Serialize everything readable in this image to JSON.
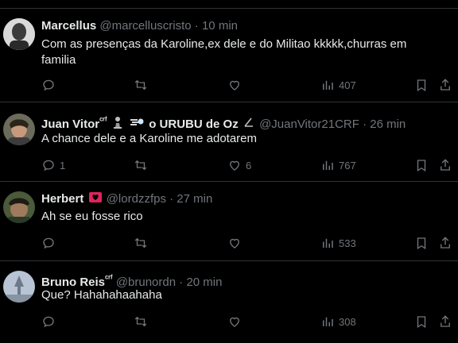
{
  "colors": {
    "background": "#000000",
    "text": "#e7e9ea",
    "muted": "#71767b",
    "divider": "#2f3336"
  },
  "tweets": [
    {
      "name": "Marcellus",
      "handle": "@marcelluscristo",
      "dot": "·",
      "time": "10 min",
      "text": "Com as presenças da Karoline,ex dele e do Militao kkkkk,churras em familia",
      "replies": "",
      "retweets": "",
      "likes": "",
      "views": "407"
    },
    {
      "name": "Juan Vitor",
      "badge": "ᶜʳᶠ",
      "name_suffix": "o URUBU de Oz",
      "handle": "@JuanVitor21CRF",
      "dot": "·",
      "time": "26 min",
      "text": "A chance dele e a Karoline me adotarem",
      "replies": "1",
      "retweets": "",
      "likes": "6",
      "views": "767"
    },
    {
      "name": "Herbert",
      "handle": "@lordzzfps",
      "dot": "·",
      "time": "27 min",
      "text": "Ah se eu fosse rico",
      "replies": "",
      "retweets": "",
      "likes": "",
      "views": "533"
    },
    {
      "name": "Bruno Reis",
      "badge": "ᶜʳᶠ",
      "handle": "@brunordn",
      "dot": "·",
      "time": "20 min",
      "text": "Que? Hahahahaahaha",
      "replies": "",
      "retweets": "",
      "likes": "",
      "views": "308"
    }
  ]
}
